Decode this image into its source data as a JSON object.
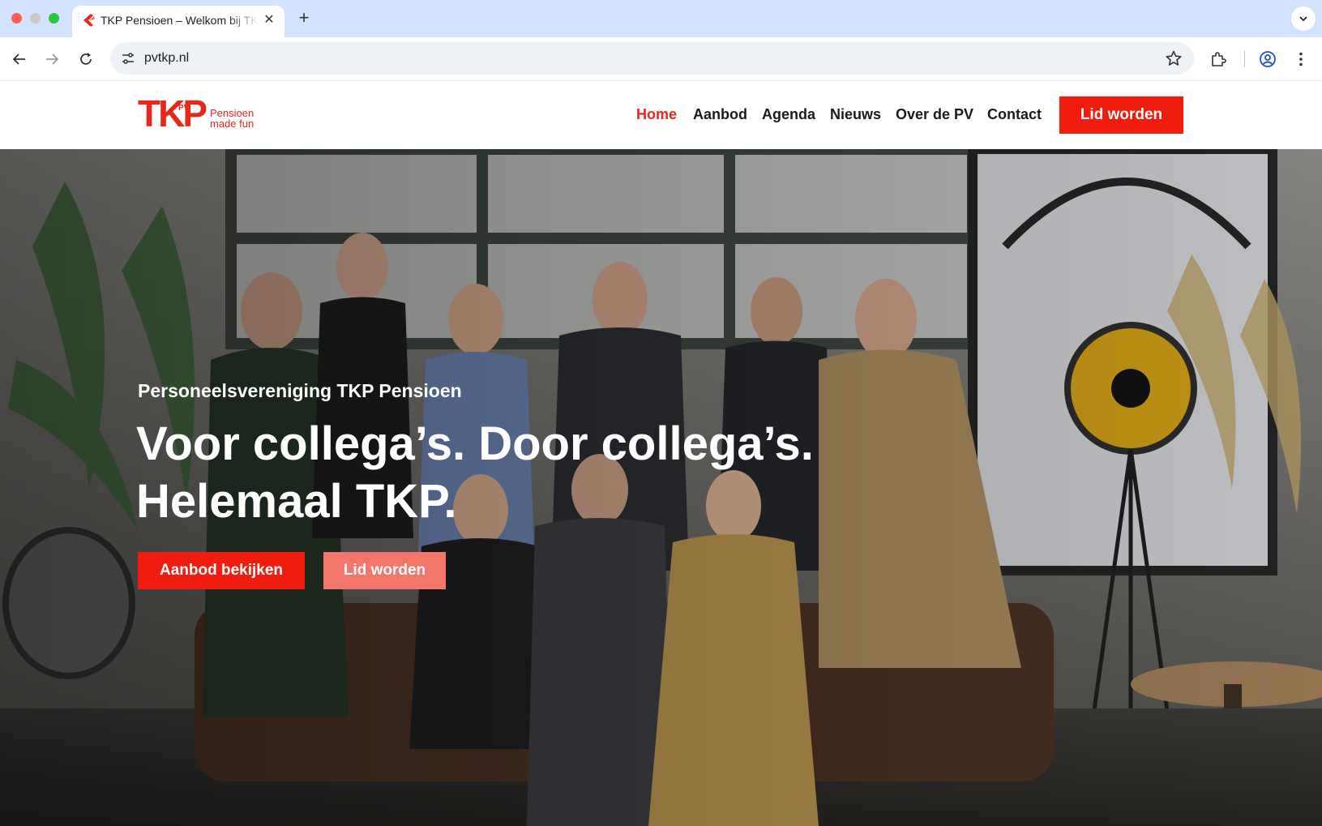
{
  "browser": {
    "tab_title": "TKP Pensioen – Welkom bij TKP Pensioen",
    "url": "pvtkp.nl",
    "icons": {
      "favicon": "tkp-favicon",
      "close": "close-icon",
      "new_tab": "plus-icon",
      "tab_list": "chevron-down-icon",
      "back": "arrow-left-icon",
      "forward": "arrow-right-icon",
      "reload": "reload-icon",
      "site_info": "tune-icon",
      "bookmark": "star-icon",
      "extensions": "puzzle-icon",
      "profile": "profile-icon",
      "menu": "kebab-menu-icon"
    },
    "symbols": {
      "close": "✕",
      "new_tab": "+"
    }
  },
  "site": {
    "logo_text": "TKP",
    "logo_badge": "PV",
    "tagline_line1": "Pensioen",
    "tagline_line2": "made fun",
    "nav": [
      {
        "label": "Home",
        "active": true
      },
      {
        "label": "Aanbod",
        "active": false
      },
      {
        "label": "Agenda",
        "active": false
      },
      {
        "label": "Nieuws",
        "active": false
      },
      {
        "label": "Over de PV",
        "active": false
      },
      {
        "label": "Contact",
        "active": false
      }
    ],
    "cta_label": "Lid worden"
  },
  "hero": {
    "eyebrow": "Personeelsvereniging TKP Pensioen",
    "title_line1": "Voor collega’s. Door collega’s.",
    "title_line2": "Helemaal TKP.",
    "primary_button": "Aanbod bekijken",
    "secondary_button": "Lid worden",
    "image": "group-photo-1920s-costumes"
  },
  "colors": {
    "brand_red": "#f01c0e",
    "brand_red_light": "#f2766a",
    "nav_active": "#e8261b",
    "chrome_tabstrip": "#d3e3fd"
  }
}
